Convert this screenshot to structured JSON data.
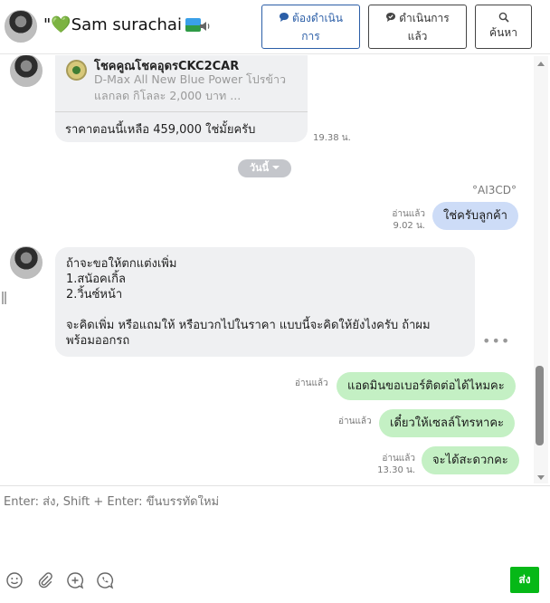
{
  "header": {
    "contact_name": "\"💚Sam surachai",
    "buttons": [
      {
        "label_line1": "ต้องดำเนิน",
        "label_line2": "การ",
        "icon": "speech-bubble-icon"
      },
      {
        "label_line1": "ดำเนินการ",
        "label_line2": "แล้ว",
        "icon": "check-bubble-icon"
      },
      {
        "label_line1": "",
        "label_line2": "ค้นหา",
        "icon": "search-icon"
      }
    ]
  },
  "messages": {
    "card": {
      "title": "โชคคูณโชคอุดรCKC2CAR",
      "description": "D-Max All New Blue Power โปรข้าวแลกลด กิโลละ 2,000 บาท ...",
      "footer": "ราคาตอนนี้เหลือ 459,000 ใช่มั้ยครับ",
      "time": "19.38 น."
    },
    "day_separator": "วันนี้",
    "sender_id": "°AI3CD°",
    "out1": {
      "text": "ใช่ครับลูกค้า",
      "read": "อ่านแล้ว",
      "time": "9.02 น."
    },
    "in_multi": {
      "lines": [
        "ถ้าจะขอให้ตกแต่งเพิ่ม",
        "1.สนัอคเกิ้ล",
        "2.วิ้นซ์หน้า",
        "",
        "จะคิดเพิ่ม หรือแถมให้ หรือบวกไปในราคา  แบบนี้จะคิดให้ยังไงครับ  ถ้าผม",
        "พร้อมออกรถ"
      ]
    },
    "out2": {
      "text": "แอดมินขอเบอร์ติดต่อได้ไหมคะ",
      "read": "อ่านแล้ว"
    },
    "out3": {
      "text": "เดี๋ยวให้เซลล์โทรหาคะ",
      "read": "อ่านแล้ว"
    },
    "out4": {
      "text": "จะได้สะดวกคะ",
      "read": "อ่านแล้ว",
      "time": "13.30 น."
    }
  },
  "composer": {
    "placeholder": "Enter: ส่ง, Shift + Enter: ขึ้นบรรทัดใหม่",
    "send_label": "ส่ง",
    "tools": [
      "smiley-icon",
      "paperclip-icon",
      "plus-circle-icon",
      "phone-bubble-icon"
    ]
  },
  "colors": {
    "accent_blue": "#2b5ea7",
    "bubble_out": "#c4f0c4",
    "bubble_out_blue": "#cddcf7",
    "bubble_in": "#eff0f2",
    "send_green": "#06b817"
  }
}
